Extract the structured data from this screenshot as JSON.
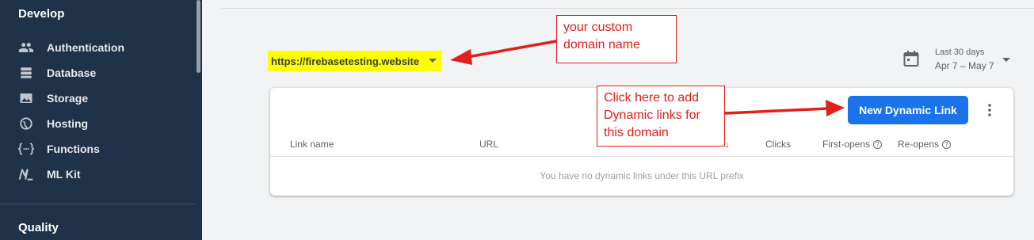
{
  "sidebar": {
    "section_develop": "Develop",
    "section_quality": "Quality",
    "items": [
      {
        "label": "Authentication",
        "icon": "people-icon"
      },
      {
        "label": "Database",
        "icon": "database-icon"
      },
      {
        "label": "Storage",
        "icon": "image-icon"
      },
      {
        "label": "Hosting",
        "icon": "globe-icon"
      },
      {
        "label": "Functions",
        "icon": "functions-icon"
      },
      {
        "label": "ML Kit",
        "icon": "ml-kit-icon"
      }
    ]
  },
  "domain_selector": {
    "value": "https://firebasetesting.website",
    "highlight_color": "#ffff00"
  },
  "date_range": {
    "label": "Last 30 days",
    "range": "Apr 7 – May 7"
  },
  "card": {
    "new_button_label": "New Dynamic Link",
    "columns": [
      "Link name",
      "URL",
      "Clicks",
      "First-opens",
      "Re-opens"
    ],
    "empty_message": "You have no dynamic links under this URL prefix"
  },
  "annotations": {
    "domain_note_line1": "your custom",
    "domain_note_line2": "domain name",
    "button_note_line1": "Click here to add",
    "button_note_line2": "Dynamic links for",
    "button_note_line3": "this domain",
    "color": "#e0201a"
  },
  "colors": {
    "sidebar_bg": "#1f3247",
    "primary": "#1a73e8",
    "page_bg": "#f1f3f4"
  }
}
